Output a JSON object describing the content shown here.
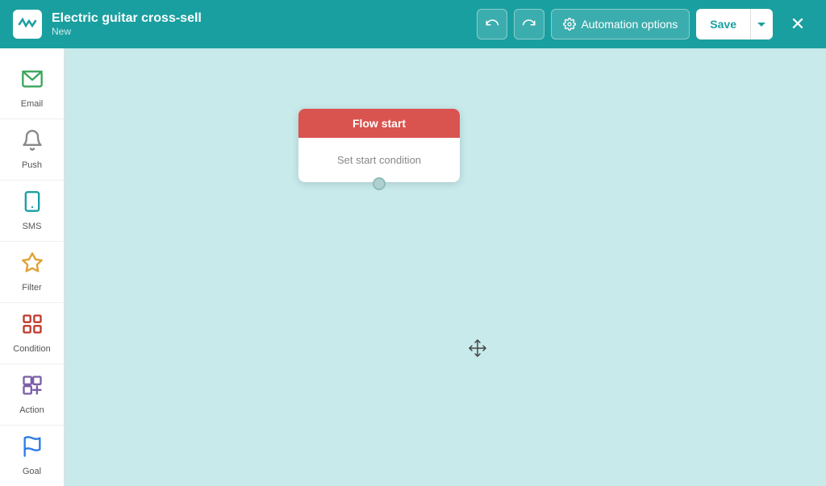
{
  "header": {
    "logo_alt": "logo",
    "title": "Electric guitar cross-sell",
    "subtitle": "New",
    "undo_label": "↩",
    "redo_label": "↪",
    "automation_options_label": "Automation options",
    "save_label": "Save",
    "close_label": "✕"
  },
  "sidebar": {
    "items": [
      {
        "id": "email",
        "label": "Email",
        "icon": "email"
      },
      {
        "id": "push",
        "label": "Push",
        "icon": "push"
      },
      {
        "id": "sms",
        "label": "SMS",
        "icon": "sms"
      },
      {
        "id": "filter",
        "label": "Filter",
        "icon": "filter"
      },
      {
        "id": "condition",
        "label": "Condition",
        "icon": "condition"
      },
      {
        "id": "action",
        "label": "Action",
        "icon": "action"
      },
      {
        "id": "goal",
        "label": "Goal",
        "icon": "goal"
      }
    ]
  },
  "canvas": {
    "flow_node": {
      "header": "Flow start",
      "body": "Set start condition"
    }
  }
}
